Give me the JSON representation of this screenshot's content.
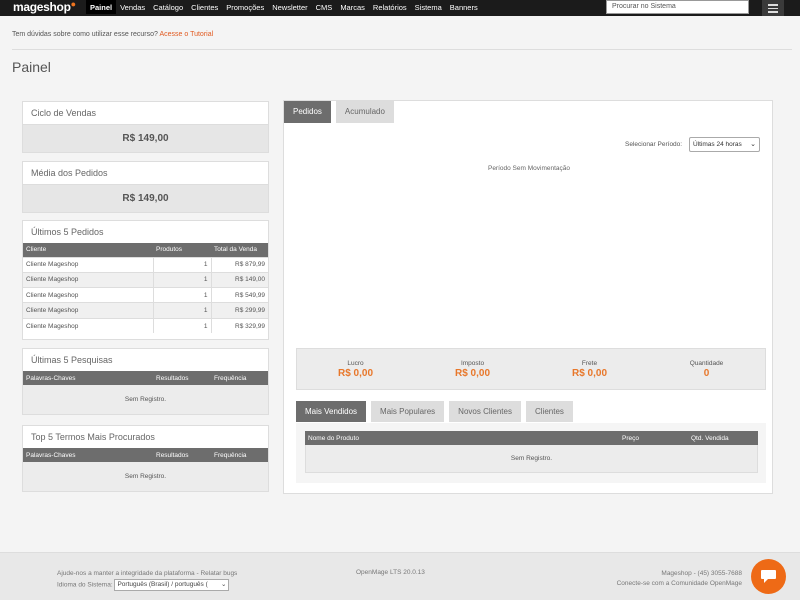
{
  "header": {
    "logo": "mageshop",
    "nav": [
      "Painel",
      "Vendas",
      "Catálogo",
      "Clientes",
      "Promoções",
      "Newsletter",
      "CMS",
      "Marcas",
      "Relatórios",
      "Sistema",
      "Banners"
    ],
    "active_nav": "Painel",
    "search_placeholder": "Procurar no Sistema"
  },
  "help": {
    "text": "Tem dúvidas sobre como utilizar esse recurso?",
    "link": "Acesse o Tutorial"
  },
  "page_title": "Painel",
  "sales_cycle": {
    "title": "Ciclo de Vendas",
    "value": "R$ 149,00"
  },
  "avg_orders": {
    "title": "Média dos Pedidos",
    "value": "R$ 149,00"
  },
  "last_orders": {
    "title": "Últimos 5 Pedidos",
    "columns": [
      "Cliente",
      "Produtos",
      "Total da Venda"
    ],
    "rows": [
      [
        "Cliente Mageshop",
        "1",
        "R$ 879,99"
      ],
      [
        "Cliente Mageshop",
        "1",
        "R$ 149,00"
      ],
      [
        "Cliente Mageshop",
        "1",
        "R$ 549,99"
      ],
      [
        "Cliente Mageshop",
        "1",
        "R$ 299,99"
      ],
      [
        "Cliente Mageshop",
        "1",
        "R$ 329,99"
      ]
    ]
  },
  "last_searches": {
    "title": "Últimas 5 Pesquisas",
    "columns": [
      "Palavras-Chaves",
      "Resultados",
      "Frequência"
    ],
    "empty": "Sem Registro."
  },
  "top_terms": {
    "title": "Top 5 Termos Mais Procurados",
    "columns": [
      "Palavras-Chaves",
      "Resultados",
      "Frequência"
    ],
    "empty": "Sem Registro."
  },
  "main": {
    "tabs": [
      "Pedidos",
      "Acumulado"
    ],
    "active_tab": "Pedidos",
    "period_label": "Selecionar Período:",
    "period_value": "Últimas 24 horas",
    "no_movement": "Período Sem Movimentação",
    "totals": [
      {
        "label": "Lucro",
        "value": "R$ 0,00"
      },
      {
        "label": "Imposto",
        "value": "R$ 0,00"
      },
      {
        "label": "Frete",
        "value": "R$ 0,00"
      },
      {
        "label": "Quantidade",
        "value": "0"
      }
    ],
    "sub_tabs": [
      "Mais Vendidos",
      "Mais Populares",
      "Novos Clientes",
      "Clientes"
    ],
    "active_sub_tab": "Mais Vendidos",
    "product_columns": [
      "Nome do Produto",
      "Preço",
      "Qtd. Vendida"
    ],
    "product_empty": "Sem Registro."
  },
  "footer": {
    "help_text": "Ajude-nos a manter a integridade da plataforma - ",
    "report_link": "Relatar bugs",
    "lang_label": "Idioma do Sistema:",
    "lang_value": "Português (Brasil) / português (",
    "version": "OpenMage LTS 20.0.13",
    "contact": "Mageshop - (45) 3055-7688",
    "community": "Conecte-se com a Comunidade OpenMage"
  },
  "colors": {
    "accent": "#e8772a",
    "nav_bg": "#1b1b1b",
    "table_head": "#6d6d6d",
    "chat": "#ee6a16"
  }
}
